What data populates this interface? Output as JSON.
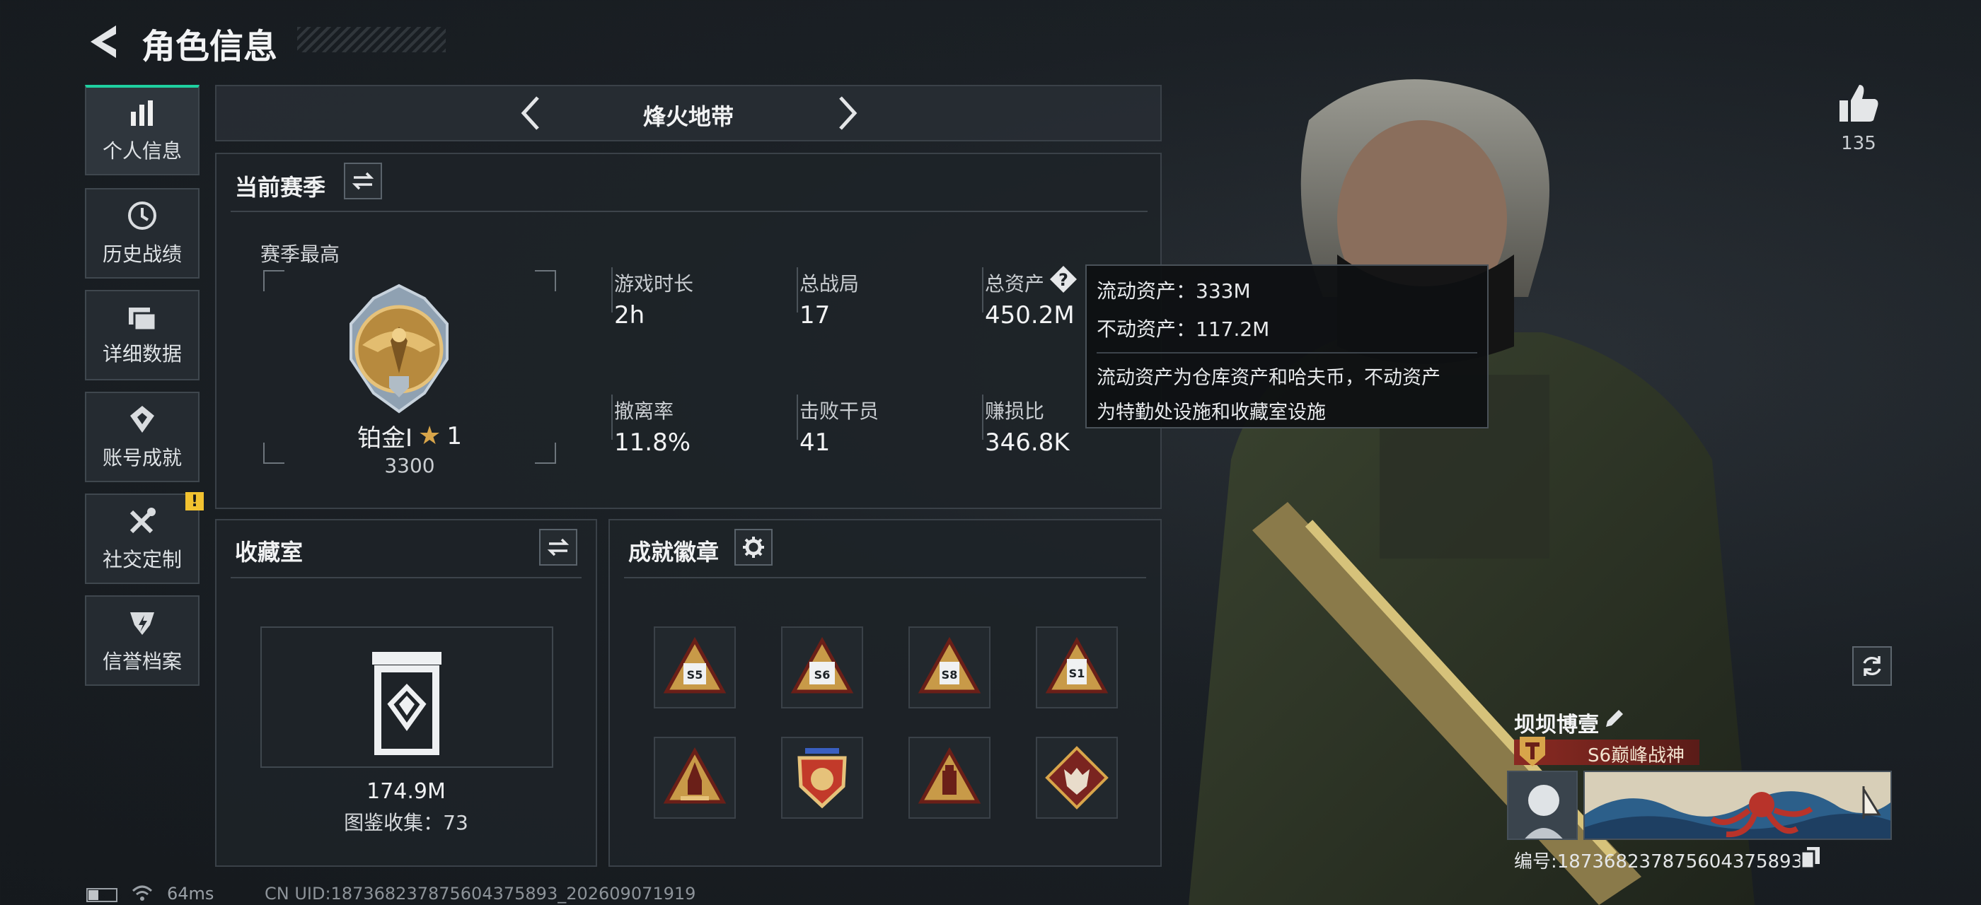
{
  "header": {
    "title": "角色信息"
  },
  "sidebar": {
    "items": [
      {
        "label": "个人信息",
        "icon": "bar-chart-icon"
      },
      {
        "label": "历史战绩",
        "icon": "history-icon"
      },
      {
        "label": "详细数据",
        "icon": "folders-icon"
      },
      {
        "label": "账号成就",
        "icon": "achievement-icon"
      },
      {
        "label": "社交定制",
        "icon": "tools-icon"
      },
      {
        "label": "信誉档案",
        "icon": "reputation-icon"
      }
    ]
  },
  "mode": {
    "label": "烽火地带"
  },
  "season": {
    "title": "当前赛季",
    "best_label": "赛季最高",
    "rank_name": "铂金I",
    "rank_stars": "1",
    "rank_score": "3300",
    "stats": [
      {
        "label": "游戏时长",
        "value": "2h"
      },
      {
        "label": "总战局",
        "value": "17"
      },
      {
        "label": "总资产",
        "value": "450.2M"
      },
      {
        "label": "撤离率",
        "value": "11.8%"
      },
      {
        "label": "击败干员",
        "value": "41"
      },
      {
        "label": "赚损比",
        "value": "346.8K"
      }
    ]
  },
  "tooltip": {
    "line1": "流动资产：333M",
    "line2": "不动资产：117.2M",
    "desc1": "流动资产为仓库资产和哈夫币，不动资产",
    "desc2": "为特勤处设施和收藏室设施"
  },
  "collection": {
    "title": "收藏室",
    "value": "174.9M",
    "catalog": "图鉴收集：73"
  },
  "badges": {
    "title": "成就徽章",
    "items": [
      {
        "icon": "badge-s5-icon",
        "text": "S5"
      },
      {
        "icon": "badge-s6-icon",
        "text": "S6"
      },
      {
        "icon": "badge-s8-icon",
        "text": "S8"
      },
      {
        "icon": "badge-s1-icon",
        "text": "S1"
      },
      {
        "icon": "badge-rocket-icon",
        "text": ""
      },
      {
        "icon": "badge-shield-icon",
        "text": ""
      },
      {
        "icon": "badge-bottle-icon",
        "text": ""
      },
      {
        "icon": "badge-wolf-icon",
        "text": ""
      }
    ]
  },
  "likes": {
    "count": "135"
  },
  "player": {
    "name": "坝坝博壹",
    "title": "S6巅峰战神",
    "id_text": "编号:187368237875604375893"
  },
  "footer": {
    "ping": "64ms",
    "uid": "CN UID:187368237875604375893_202609071919"
  },
  "colors": {
    "accent": "#1fd0a0",
    "gold": "#d8a54a",
    "title_red": "#7a2420",
    "warning": "#f2c230"
  }
}
